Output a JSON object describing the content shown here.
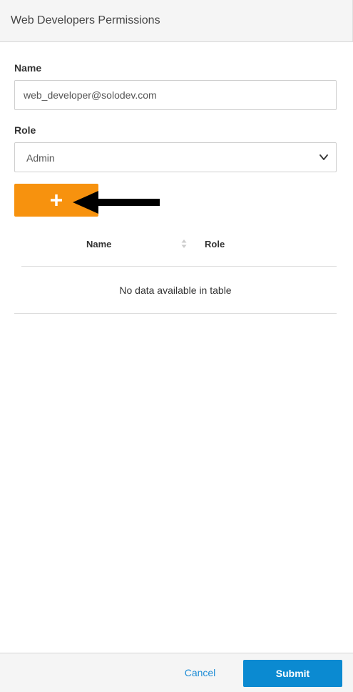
{
  "header": {
    "title": "Web Developers Permissions"
  },
  "form": {
    "name_label": "Name",
    "name_value": "web_developer@solodev.com",
    "role_label": "Role",
    "role_value": "Admin",
    "add_button_icon": "plus-icon"
  },
  "table": {
    "columns": [
      "Name",
      "Role"
    ],
    "empty_message": "No data available in table"
  },
  "footer": {
    "cancel_label": "Cancel",
    "submit_label": "Submit"
  },
  "colors": {
    "accent_orange": "#f7920e",
    "primary_blue": "#0b8ad1",
    "link_blue": "#1f8dd6"
  },
  "annotation": {
    "icon": "arrow-left-icon"
  }
}
